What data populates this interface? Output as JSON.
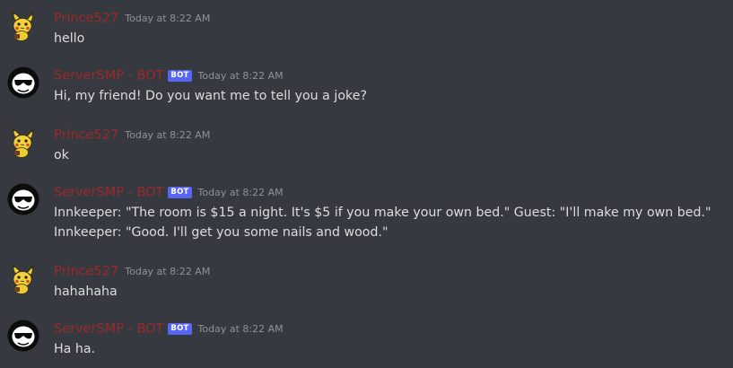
{
  "colors": {
    "background": "#36393f",
    "username": "#9b2a2a",
    "badge": "#5865f2",
    "timestamp": "#8e9297",
    "message_text": "#dcddde"
  },
  "messages": [
    {
      "author": "Prince527",
      "avatar": "pikachu-avatar",
      "bot": false,
      "badge": "",
      "timestamp": "Today at 8:22 AM",
      "text": "hello"
    },
    {
      "author": "ServerSMP - BOT",
      "avatar": "sunglasses-face-avatar",
      "bot": true,
      "badge": "BOT",
      "timestamp": "Today at 8:22 AM",
      "text": "Hi, my friend! Do you want me to tell you a joke?"
    },
    {
      "author": "Prince527",
      "avatar": "pikachu-avatar",
      "bot": false,
      "badge": "",
      "timestamp": "Today at 8:22 AM",
      "text": "ok"
    },
    {
      "author": "ServerSMP - BOT",
      "avatar": "sunglasses-face-avatar",
      "bot": true,
      "badge": "BOT",
      "timestamp": "Today at 8:22 AM",
      "text": "Innkeeper: \"The room is $15 a night. It's $5 if you make your own bed.\" Guest: \"I'll make my own bed.\" Innkeeper: \"Good. I'll get you some nails and wood.\""
    },
    {
      "author": "Prince527",
      "avatar": "pikachu-avatar",
      "bot": false,
      "badge": "",
      "timestamp": "Today at 8:22 AM",
      "text": "hahahaha"
    },
    {
      "author": "ServerSMP - BOT",
      "avatar": "sunglasses-face-avatar",
      "bot": true,
      "badge": "BOT",
      "timestamp": "Today at 8:22 AM",
      "text": "Ha ha."
    }
  ]
}
